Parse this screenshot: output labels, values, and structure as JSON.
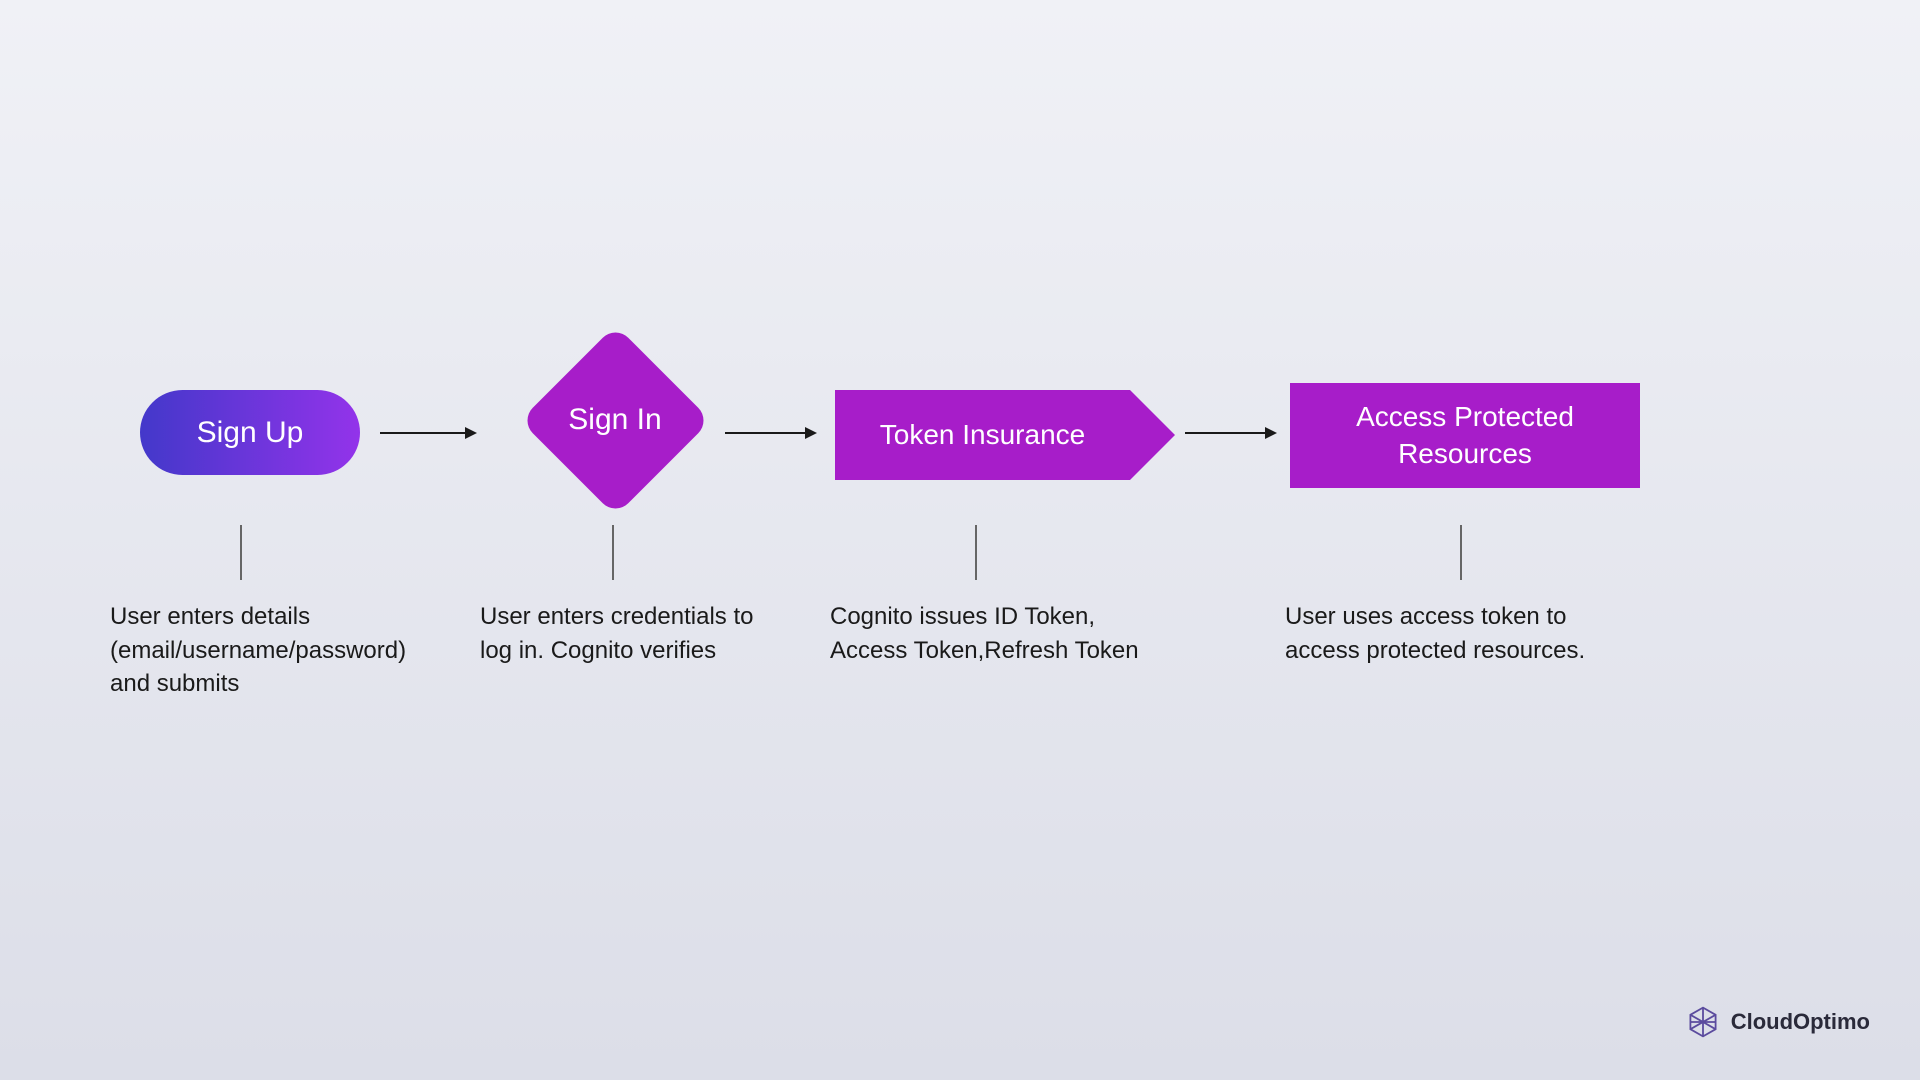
{
  "flow": {
    "steps": [
      {
        "label": "Sign Up",
        "description": "User enters details (email/username/password) and submits"
      },
      {
        "label": "Sign In",
        "description": "User enters credentials to log in. Cognito verifies"
      },
      {
        "label": "Token Insurance",
        "description": "Cognito issues ID Token, Access Token,Refresh Token"
      },
      {
        "label": "Access Protected Resources",
        "description": "User uses access token to access protected resources."
      }
    ]
  },
  "branding": {
    "name": "CloudOptimo"
  },
  "colors": {
    "purple": "#a71dc9",
    "gradient_start": "#4338ca",
    "gradient_end": "#9333ea"
  }
}
